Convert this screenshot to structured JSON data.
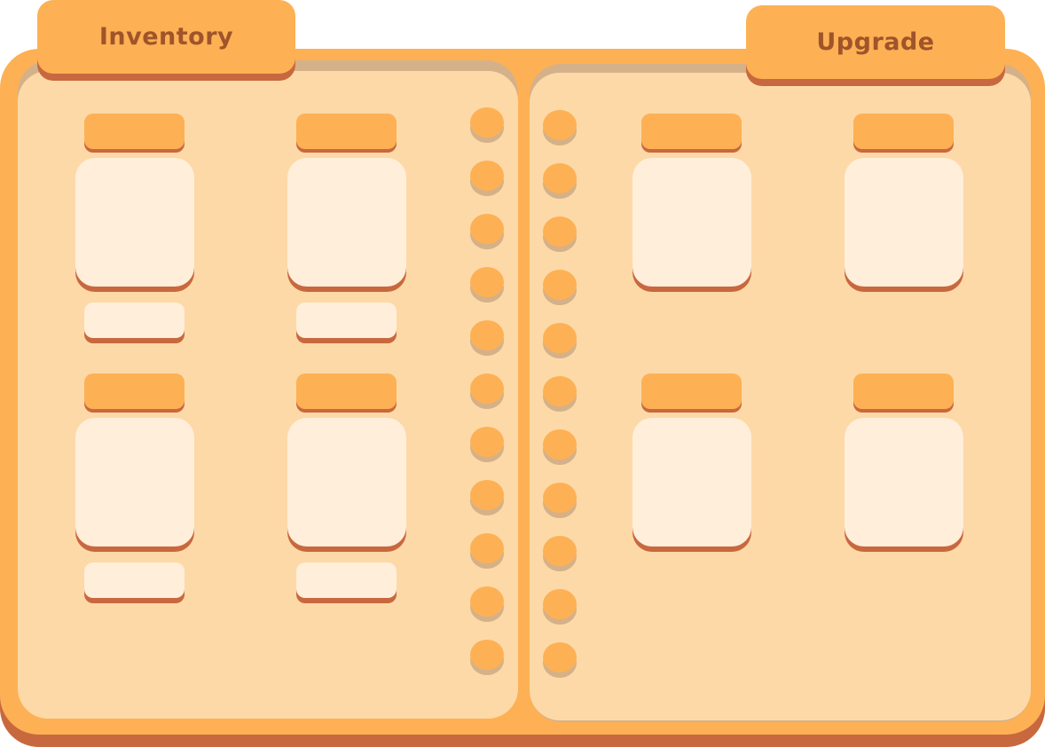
{
  "tabs": {
    "inventory_label": "Inventory",
    "upgrade_label": "Upgrade"
  },
  "colors": {
    "frame": "#fdb154",
    "frame_shadow": "#c8683f",
    "page": "#fdd9a8",
    "card": "#ffeeda",
    "tab_text": "#a0542a"
  }
}
